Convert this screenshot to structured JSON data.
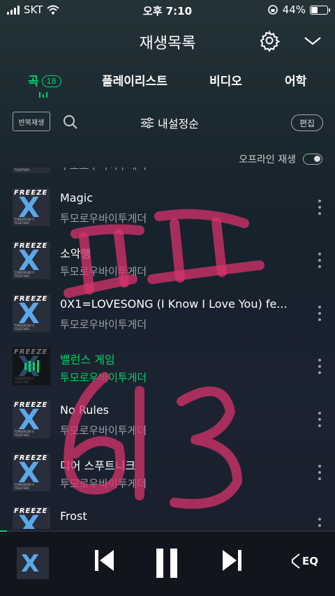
{
  "status_bar": {
    "carrier": "SKT",
    "time": "오후 7:10",
    "battery": "44%",
    "battery_level": 0.44
  },
  "header": {
    "title": "재생목록",
    "settings_icon": "gear-icon",
    "collapse_icon": "chevron-down-icon"
  },
  "tabs": [
    {
      "label": "곡",
      "count": "18",
      "active": true
    },
    {
      "label": "플레이리스트"
    },
    {
      "label": "비디오"
    },
    {
      "label": "어학"
    }
  ],
  "toolbar": {
    "repeat_label": "반복재생",
    "sort_label": "내설정순",
    "edit_label": "편집"
  },
  "offline": {
    "label": "오프라인 재생"
  },
  "album": {
    "brand": "FREEZE",
    "mark": "X",
    "caption": "TOMORROW X TOGETHER"
  },
  "songs": [
    {
      "title": "",
      "artist": "투모로우바이투게더"
    },
    {
      "title": "Magic",
      "artist": "투모로우바이투게더"
    },
    {
      "title": "소악행",
      "artist": "투모로우바이투게더"
    },
    {
      "title": "0X1=LOVESONG (I Know I Love You) fe...",
      "artist": "투모로우바이투게더"
    },
    {
      "title": "밸런스 게임",
      "artist": "투모로우바이투게더",
      "playing": true
    },
    {
      "title": "No Rules",
      "artist": "투모로우바이투게더"
    },
    {
      "title": "디어 스푸트니크",
      "artist": "투모로우바이투게더"
    },
    {
      "title": "Frost",
      "artist": ""
    }
  ],
  "player": {
    "eq_label": "EQ",
    "progress": 0.02
  },
  "colors": {
    "accent": "#00d36a",
    "overlay": "#d8336c"
  }
}
